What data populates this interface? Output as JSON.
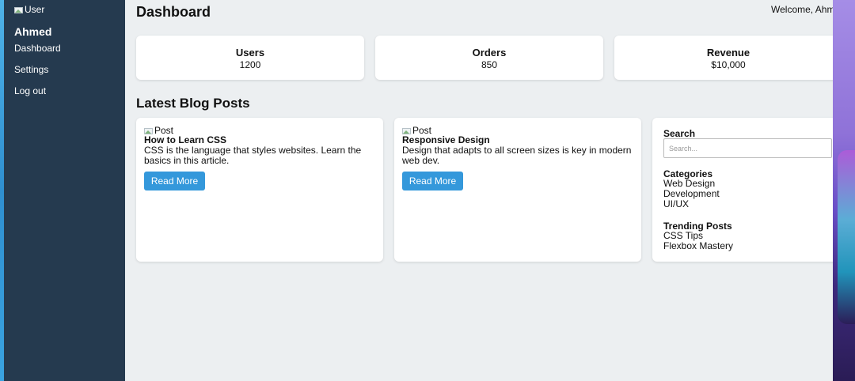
{
  "sidebar": {
    "user_image_alt": "User",
    "user_name": "Ahmed",
    "links": [
      "Dashboard",
      "Settings",
      "Log out"
    ]
  },
  "header": {
    "title": "Dashboard",
    "welcome_text": "Welcome, Ahme"
  },
  "stats": [
    {
      "label": "Users",
      "value": "1200"
    },
    {
      "label": "Orders",
      "value": "850"
    },
    {
      "label": "Revenue",
      "value": "$10,000"
    }
  ],
  "blog": {
    "section_title": "Latest Blog Posts",
    "posts": [
      {
        "image_alt": "Post",
        "title": "How to Learn CSS",
        "excerpt": "CSS is the language that styles websites. Learn the basics in this article.",
        "button_label": "Read More"
      },
      {
        "image_alt": "Post",
        "title": "Responsive Design",
        "excerpt": "Design that adapts to all screen sizes is key in modern web dev.",
        "button_label": "Read More"
      }
    ]
  },
  "aside": {
    "search_heading": "Search",
    "search_placeholder": "Search...",
    "search_value": "",
    "categories_heading": "Categories",
    "categories": [
      "Web Design",
      "Development",
      "UI/UX"
    ],
    "trending_heading": "Trending Posts",
    "trending": [
      "CSS Tips",
      "Flexbox Mastery"
    ]
  },
  "colors": {
    "sidebar_bg": "#253a4f",
    "page_bg": "#eceff1",
    "button_bg": "#3498db"
  },
  "icons": {
    "broken_image": "broken-image-icon"
  }
}
